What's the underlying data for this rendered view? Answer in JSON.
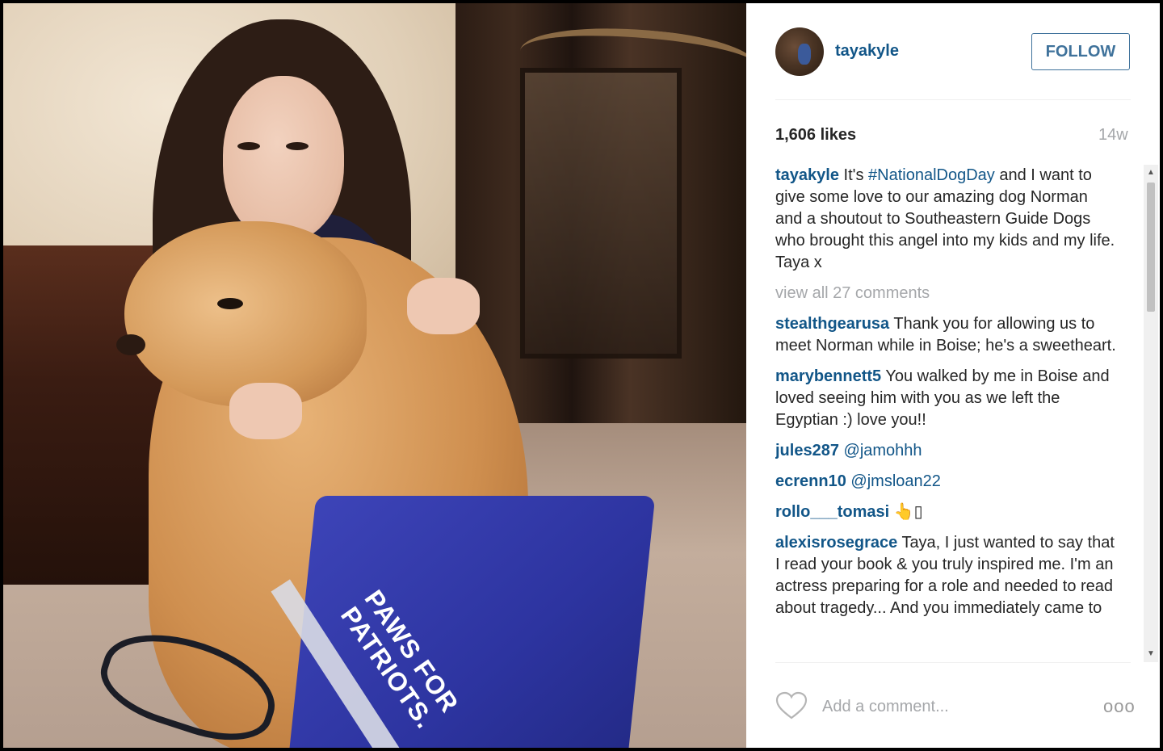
{
  "post": {
    "photo_text": "PAWS FOR\nPATRIOTS."
  },
  "header": {
    "username": "tayakyle",
    "follow_label": "FOLLOW"
  },
  "stats": {
    "likes": "1,606 likes",
    "age": "14w"
  },
  "caption": {
    "user": "tayakyle",
    "prefix": "It's ",
    "hashtag": "#NationalDogDay",
    "suffix": " and I want to give some love to our amazing dog Norman and a shoutout to Southeastern Guide Dogs who brought this angel into my kids and my life. Taya x"
  },
  "view_all": "view all 27 comments",
  "comments": [
    {
      "user": "stealthgearusa",
      "text": "Thank you for allowing us to meet Norman while in Boise; he's a sweetheart."
    },
    {
      "user": "marybennett5",
      "text": "You walked by me in Boise and loved seeing him with you as we left the Egyptian :) love you!!"
    },
    {
      "user": "jules287",
      "text": "",
      "mention": "@jamohhh"
    },
    {
      "user": "ecrenn10",
      "text": "",
      "mention": "@jmsloan22"
    },
    {
      "user": "rollo___tomasi",
      "text": "👆▯"
    },
    {
      "user": "alexisrosegrace",
      "text": "Taya, I just wanted to say that I read your book & you truly inspired me. I'm an actress preparing for a role and needed to read about tragedy... And you immediately came to"
    }
  ],
  "footer": {
    "add_comment_placeholder": "Add a comment...",
    "more_label": "ooo"
  },
  "icons": {
    "heart": "heart-icon",
    "more": "more-options-icon"
  },
  "colors": {
    "link": "#125688",
    "follow": "#3f729b",
    "muted": "#a5a7aa",
    "text": "#262626"
  }
}
